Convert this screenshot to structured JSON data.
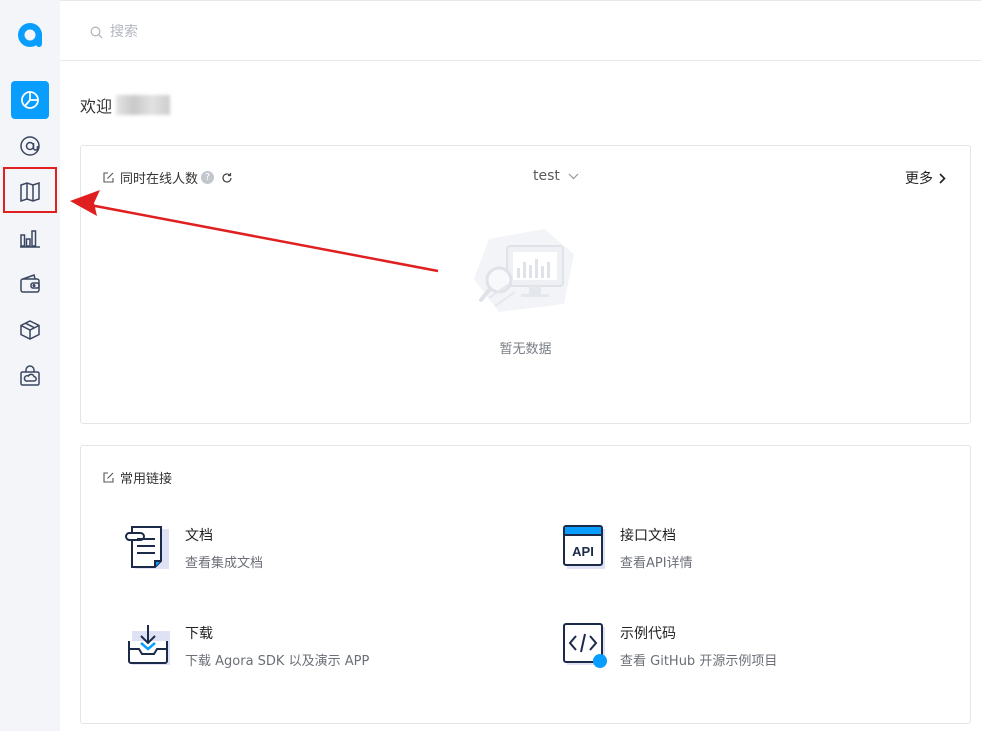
{
  "sidebar": {
    "logo": "agora-logo-icon",
    "items": [
      {
        "icon": "dashboard-pie-icon",
        "active": true
      },
      {
        "icon": "at-sign-icon",
        "active": false
      },
      {
        "icon": "map-icon",
        "active": false,
        "highlighted": true
      },
      {
        "icon": "bar-chart-icon",
        "active": false
      },
      {
        "icon": "wallet-icon",
        "active": false
      },
      {
        "icon": "cube-icon",
        "active": false
      },
      {
        "icon": "cloud-bag-icon",
        "active": false
      }
    ]
  },
  "topbar": {
    "search_placeholder": "搜索"
  },
  "welcome": {
    "label": "欢迎"
  },
  "online_card": {
    "title": "同时在线人数",
    "help": "?",
    "project": "test",
    "more": "更多",
    "empty_text": "暂无数据"
  },
  "links_card": {
    "title": "常用链接",
    "items": [
      {
        "title": "文档",
        "desc": "查看集成文档",
        "icon": "document-icon"
      },
      {
        "title": "接口文档",
        "desc": "查看API详情",
        "icon": "api-icon",
        "icon_text": "API"
      },
      {
        "title": "下载",
        "desc": "下载 Agora SDK 以及演示 APP",
        "icon": "download-icon"
      },
      {
        "title": "示例代码",
        "desc": "查看 GitHub 开源示例项目",
        "icon": "code-icon"
      }
    ]
  },
  "colors": {
    "accent": "#099dfd",
    "highlight": "#e02020",
    "icon_dark": "#1c2a4a"
  }
}
